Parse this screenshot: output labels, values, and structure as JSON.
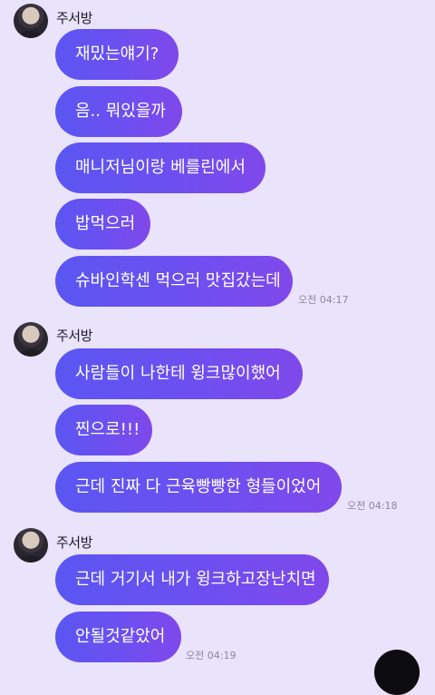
{
  "groups": [
    {
      "sender": "주서방",
      "messages": [
        "재밌는얘기?",
        "음.. 뭐있을까",
        "매니저님이랑 베를린에서",
        "밥먹으러",
        "슈바인학센 먹으러 맛집갔는데"
      ],
      "time": "오전 04:17"
    },
    {
      "sender": "주서방",
      "messages": [
        "사람들이 나한테 윙크많이했어",
        "찐으로!!!",
        "근데 진짜 다 근육빵빵한 형들이었어"
      ],
      "time": "오전 04:18"
    },
    {
      "sender": "주서방",
      "messages": [
        "근데 거기서 내가 윙크하고장난치면",
        "안될것같았어"
      ],
      "time": "오전 04:19"
    }
  ]
}
